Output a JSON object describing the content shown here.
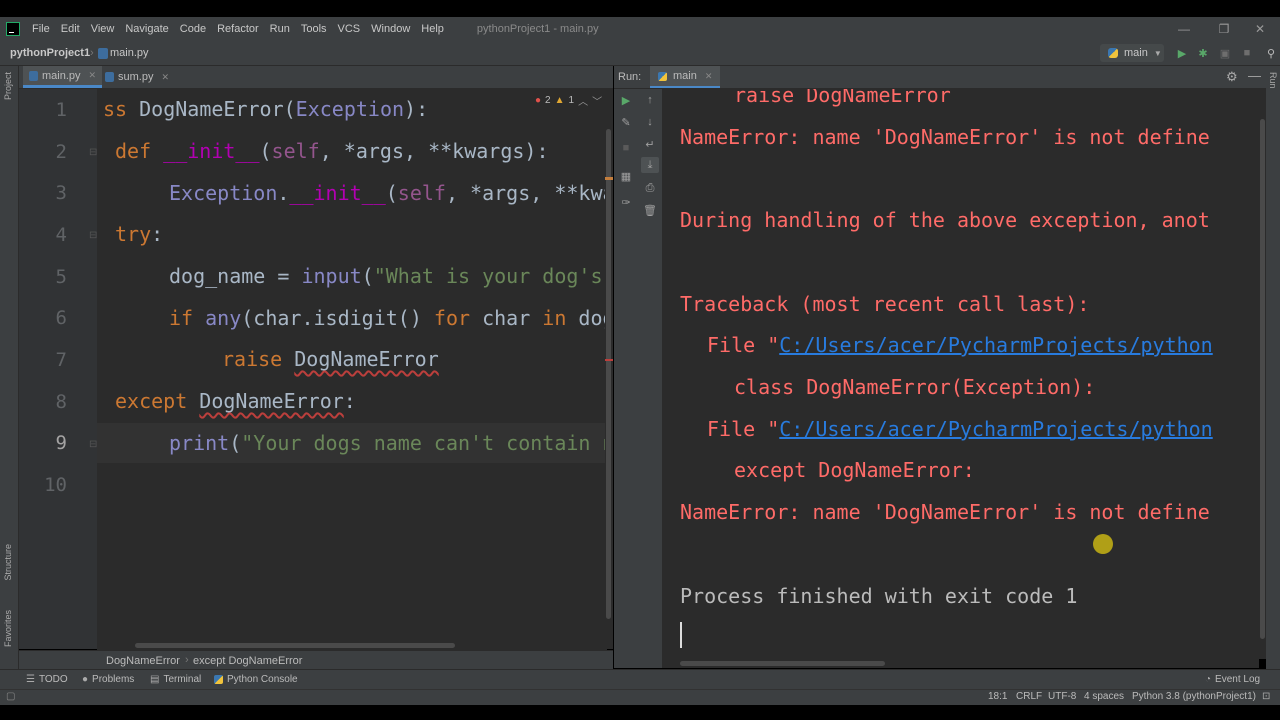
{
  "menu": {
    "items": [
      "File",
      "Edit",
      "View",
      "Navigate",
      "Code",
      "Refactor",
      "Run",
      "Tools",
      "VCS",
      "Window",
      "Help"
    ],
    "title": "pythonProject1 - main.py"
  },
  "nav": {
    "project": "pythonProject1",
    "file": "main.py",
    "branch": "main"
  },
  "left_strip": {
    "project": "Project",
    "structure": "Structure",
    "favorites": "Favorites"
  },
  "right_strip": {
    "run": "Run"
  },
  "editor": {
    "tabs": [
      {
        "label": "main.py"
      },
      {
        "label": "sum.py"
      }
    ],
    "errors": "2",
    "warnings": "1",
    "line_numbers": [
      "1",
      "2",
      "3",
      "4",
      "5",
      "6",
      "7",
      "8",
      "9",
      "10"
    ],
    "current_line": "9",
    "breadcrumb": [
      "DogNameError",
      "except DogNameError"
    ]
  },
  "run": {
    "label": "Run:",
    "tab": "main",
    "console": {
      "l1": "raise DogNameError",
      "l2": "NameError: name 'DogNameError' is not define",
      "l3": "During handling of the above exception, anot",
      "l4": "Traceback (most recent call last):",
      "l5_prefix": "File \"",
      "l5_link": "C:/Users/acer/PycharmProjects/python",
      "l6": "class DogNameError(Exception):",
      "l7_prefix": "File \"",
      "l7_link": "C:/Users/acer/PycharmProjects/python",
      "l8": "except DogNameError:",
      "l9": "NameError: name 'DogNameError' is not define",
      "l10": "Process finished with exit code 1"
    }
  },
  "toolwindows": {
    "todo": "TODO",
    "problems": "Problems",
    "terminal": "Terminal",
    "python_console": "Python Console",
    "event_log": "Event Log"
  },
  "status": {
    "position": "18:1",
    "line_sep": "CRLF",
    "encoding": "UTF-8",
    "indent": "4 spaces",
    "interpreter": "Python 3.8 (pythonProject1)"
  },
  "colors": {
    "error_text": "#ff6b68",
    "link": "#287bde",
    "keyword": "#cc7832",
    "string": "#6a8759",
    "background": "#2b2b2b"
  }
}
